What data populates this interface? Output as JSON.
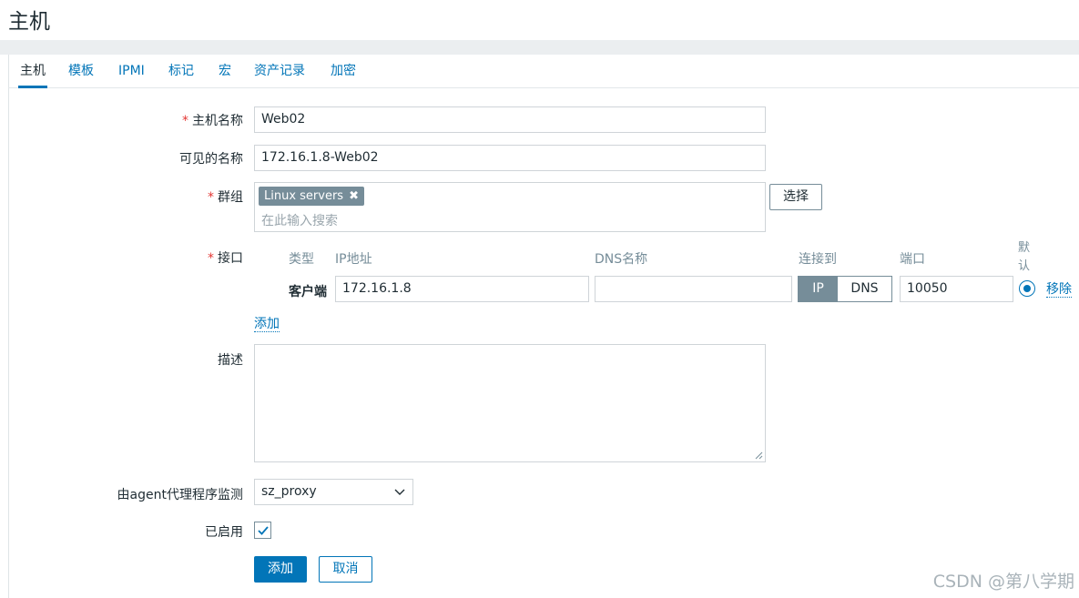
{
  "page_title": "主机",
  "tabs": [
    {
      "label": "主机",
      "active": true
    },
    {
      "label": "模板"
    },
    {
      "label": "IPMI"
    },
    {
      "label": "标记"
    },
    {
      "label": "宏"
    },
    {
      "label": "资产记录"
    },
    {
      "label": "加密"
    }
  ],
  "form": {
    "host_name": {
      "required_mark": "*",
      "label": "主机名称",
      "value": "Web02"
    },
    "visible_name": {
      "label": "可见的名称",
      "value": "172.16.1.8-Web02"
    },
    "groups": {
      "required_mark": "*",
      "label": "群组",
      "chip": "Linux servers",
      "chip_remove": "✖",
      "placeholder": "在此输入搜索",
      "select_button": "选择"
    },
    "interfaces": {
      "required_mark": "*",
      "label": "接口",
      "headers": {
        "type": "类型",
        "ip": "IP地址",
        "dns": "DNS名称",
        "connect": "连接到",
        "port": "端口",
        "default": "默认"
      },
      "row": {
        "type": "客户端",
        "ip": "172.16.1.8",
        "dns": "",
        "connect_ip": "IP",
        "connect_dns": "DNS",
        "port": "10050",
        "remove": "移除"
      },
      "add_link": "添加"
    },
    "description": {
      "label": "描述",
      "value": ""
    },
    "proxy": {
      "label": "由agent代理程序监测",
      "value": "sz_proxy"
    },
    "enabled": {
      "label": "已启用",
      "checked": true
    },
    "buttons": {
      "add": "添加",
      "cancel": "取消"
    }
  },
  "watermark": "CSDN @第八学期",
  "colors": {
    "accent": "#0275b8",
    "required": "#e33734",
    "chip": "#768d99"
  }
}
